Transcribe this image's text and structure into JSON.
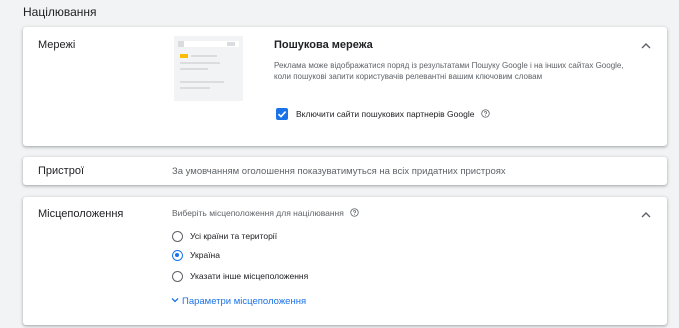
{
  "section_title": "Націлювання",
  "networks": {
    "label": "Мережі",
    "title": "Пошукова мережа",
    "description": "Реклама може відображатися поряд із результатами Пошуку Google і на інших сайтах Google, коли пошукові запити користувачів релевантні вашим ключовим словам",
    "checkbox_label": "Включити сайти пошукових партнерів Google",
    "checkbox_checked": true,
    "collapse_icon": "chevron-up-icon",
    "help_icon": "help-circle-icon",
    "illustration": "search-results-thumbnail"
  },
  "devices": {
    "label": "Пристрої",
    "text": "За умовчанням оголошення показуватимуться на всіх придатних пристроях"
  },
  "locations": {
    "label": "Місцеположення",
    "prompt": "Виберіть місцеположення для націлювання",
    "help_icon": "help-circle-icon",
    "collapse_icon": "chevron-up-icon",
    "options": [
      {
        "label": "Усі країни та території",
        "selected": false
      },
      {
        "label": "Україна",
        "selected": true
      },
      {
        "label": "Указати інше місцеположення",
        "selected": false
      }
    ],
    "link_label": "Параметри місцеположення",
    "link_icon": "chevron-down-icon"
  },
  "colors": {
    "accent": "#1a73e8",
    "text_secondary": "#5f6368",
    "background": "#f1f3f4"
  }
}
